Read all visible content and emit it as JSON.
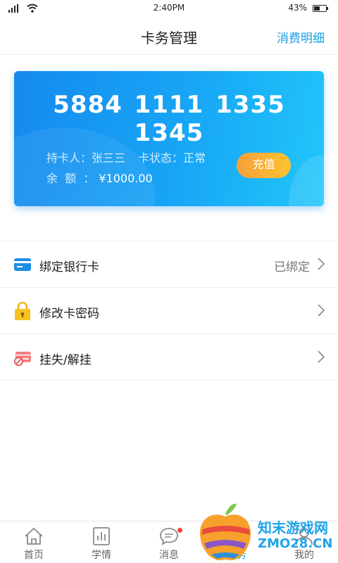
{
  "status_bar": {
    "time": "2:40PM",
    "battery_percent": "43%"
  },
  "header": {
    "title": "卡务管理",
    "right_link": "消费明细"
  },
  "card": {
    "number": "5884 1111 1335 1345",
    "holder_label": "持卡人：",
    "holder_name": "张三三",
    "status_label": "卡状态：",
    "status_value": "正常",
    "balance_label": "余  额  ：",
    "balance_value": "¥1000.00",
    "recharge_label": "充值"
  },
  "menu": [
    {
      "label": "绑定银行卡",
      "value": "已绑定",
      "icon": "bank-card-icon"
    },
    {
      "label": "修改卡密码",
      "value": "",
      "icon": "lock-icon"
    },
    {
      "label": "挂失/解挂",
      "value": "",
      "icon": "report-loss-icon"
    }
  ],
  "tabs": [
    {
      "label": "首页",
      "icon": "home-icon",
      "active": false
    },
    {
      "label": "学情",
      "icon": "chart-icon",
      "active": false
    },
    {
      "label": "消息",
      "icon": "message-icon",
      "active": false,
      "badge": true
    },
    {
      "label": "卡务",
      "icon": "card-icon",
      "active": true
    },
    {
      "label": "我的",
      "icon": "user-icon",
      "active": false
    }
  ],
  "watermark": {
    "line1": "知末游戏网",
    "line2": "ZMO28.CN"
  },
  "colors": {
    "accent": "#1a9ee5",
    "recharge_start": "#f5a03a",
    "recharge_end": "#fcc332",
    "badge": "#f0443a"
  }
}
